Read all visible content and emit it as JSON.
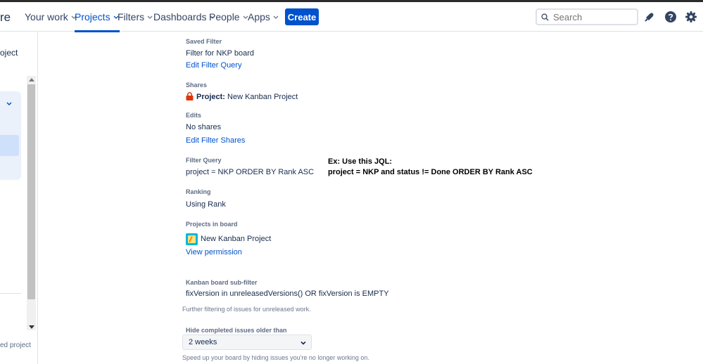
{
  "topnav": {
    "logo_fragment": "re",
    "items": [
      {
        "label": "Your work"
      },
      {
        "label": "Projects"
      },
      {
        "label": "Filters"
      },
      {
        "label": "Dashboards"
      },
      {
        "label": "People"
      },
      {
        "label": "Apps"
      }
    ],
    "active_item": "Projects",
    "create_label": "Create",
    "search_placeholder": "Search"
  },
  "sidebar": {
    "top_text": "oject",
    "bottom_text": "ed project"
  },
  "settings": {
    "saved_filter": {
      "label": "Saved Filter",
      "value": "Filter for NKP board",
      "link": "Edit Filter Query"
    },
    "shares": {
      "label": "Shares",
      "prefix": "Project:",
      "value": "New Kanban Project"
    },
    "edits": {
      "label": "Edits",
      "value": "No shares",
      "link": "Edit Filter Shares"
    },
    "filter_query": {
      "label": "Filter Query",
      "value": "project = NKP ORDER BY Rank ASC"
    },
    "ranking": {
      "label": "Ranking",
      "value": "Using Rank"
    },
    "projects_in_board": {
      "label": "Projects in board",
      "project": "New Kanban Project",
      "link": "View permission"
    },
    "kanban_subfilter": {
      "label": "Kanban board sub-filter",
      "value": "fixVersion in unreleasedVersions() OR fixVersion is EMPTY",
      "help": "Further filtering of issues for unreleased work."
    },
    "hide_completed": {
      "label": "Hide completed issues older than",
      "selected": "2 weeks",
      "help": "Speed up your board by hiding issues you're no longer working on."
    }
  },
  "annotation": {
    "line1": "Ex: Use this JQL:",
    "line2": "project = NKP and status != Done ORDER BY Rank ASC"
  },
  "colors": {
    "accent": "#0052cc",
    "lock": "#de350b",
    "project_icon": "#00b8d9"
  }
}
